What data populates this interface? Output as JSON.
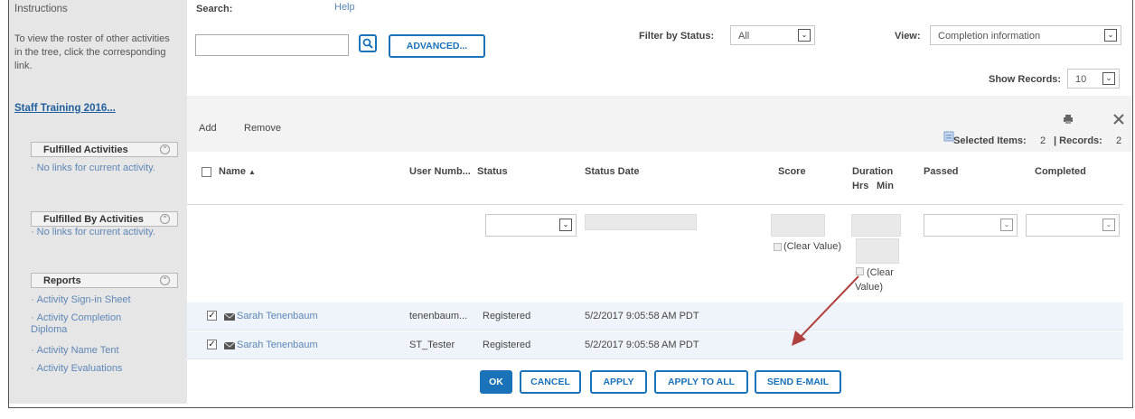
{
  "sidebar": {
    "heading": "Instructions",
    "text": "To view the roster of other activities in the tree, click the corresponding link.",
    "tree_link": "Staff Training 2016...",
    "panels": [
      {
        "title": "Fulfilled Activities",
        "items": [
          "No links for current activity."
        ]
      },
      {
        "title": "Fulfilled By Activities",
        "items": [
          "No links for current activity."
        ]
      },
      {
        "title": "Reports",
        "items": [
          "Activity Sign-in Sheet",
          "Activity Completion Diploma",
          "Activity Name Tent",
          "Activity Evaluations"
        ]
      }
    ]
  },
  "search": {
    "label": "Search:",
    "help": "Help",
    "value": "",
    "advanced_label": "ADVANCED..."
  },
  "filter": {
    "label": "Filter by Status:",
    "value": "All"
  },
  "view": {
    "label": "View:",
    "value": "Completion information"
  },
  "show_records": {
    "label": "Show Records:",
    "value": "10"
  },
  "toolbar": {
    "add": "Add",
    "remove": "Remove",
    "selected_label": "Selected Items:",
    "selected_count": "2",
    "records_label": "| Records:",
    "records_count": "2"
  },
  "columns": {
    "name": "Name",
    "user_number": "User Numb...",
    "status": "Status",
    "status_date": "Status Date",
    "score": "Score",
    "duration": "Duration",
    "duration_hrs": "Hrs",
    "duration_min": "Min",
    "passed": "Passed",
    "completed": "Completed"
  },
  "edit_row": {
    "clear_value_score": "(Clear Value)",
    "clear_value_duration_1": "(Clear",
    "clear_value_duration_2": "Value)"
  },
  "rows": [
    {
      "name": "Sarah Tenenbaum",
      "user_number": "tenenbaum...",
      "status": "Registered",
      "status_date": "5/2/2017 9:05:58 AM PDT",
      "checked": true
    },
    {
      "name": "Sarah Tenenbaum",
      "user_number": "ST_Tester",
      "status": "Registered",
      "status_date": "5/2/2017 9:05:58 AM PDT",
      "checked": true
    }
  ],
  "footer_buttons": {
    "ok": "OK",
    "cancel": "CANCEL",
    "apply": "APPLY",
    "apply_all": "APPLY TO ALL",
    "send_email": "SEND E-MAIL"
  },
  "colors": {
    "accent": "#1a72b8",
    "link": "#5d86b6",
    "arrow": "#b0413e",
    "sidebar_bg": "#e6e6e6"
  },
  "icons": {
    "search": "magnifier-icon",
    "print": "printer-icon",
    "clear": "close-icon",
    "email": "envelope-icon",
    "selected": "selected-items-icon",
    "collapse": "chevron-up-icon",
    "dropdown": "chevron-down-icon"
  }
}
